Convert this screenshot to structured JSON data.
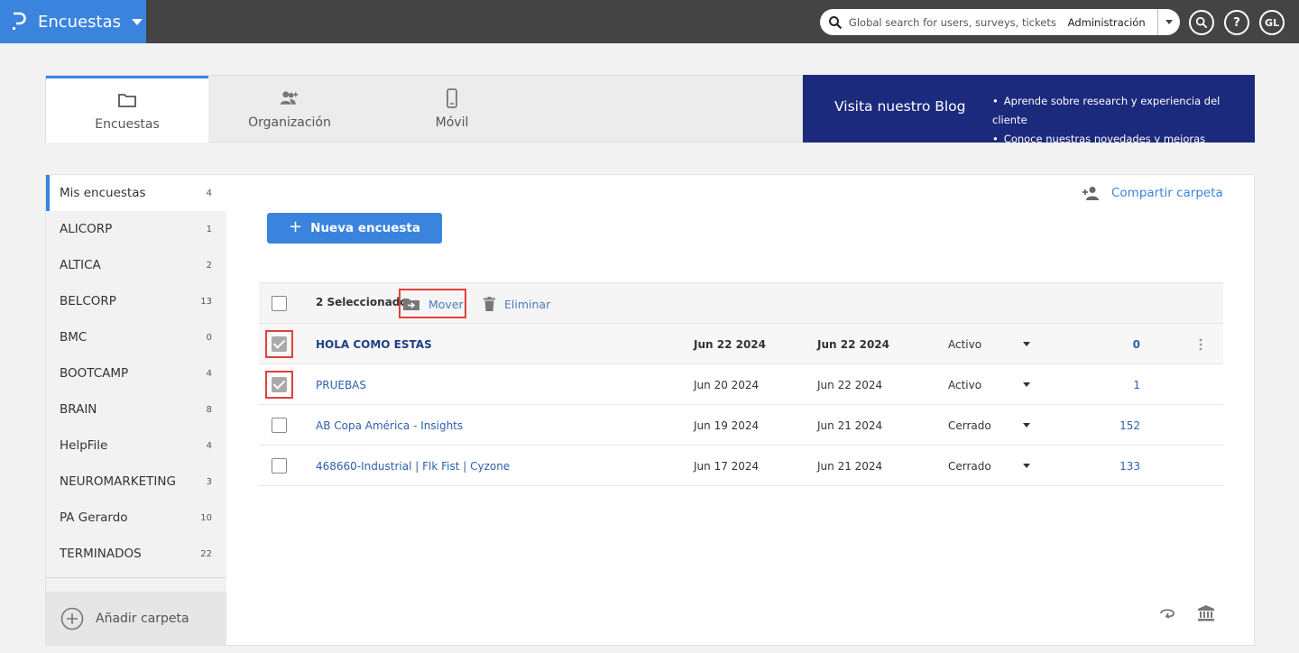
{
  "topbar": {
    "app_name": "Encuestas",
    "search_placeholder": "Global search for users, surveys, tickets",
    "search_scope": "Administración",
    "avatar_initials": "GL",
    "help_label": "?"
  },
  "tabs": [
    {
      "label": "Encuestas",
      "icon": "folder-icon"
    },
    {
      "label": "Organización",
      "icon": "add-user-icon"
    },
    {
      "label": "Móvil",
      "icon": "mobile-icon"
    }
  ],
  "blog": {
    "title": "Visita nuestro Blog",
    "points": [
      "Aprende sobre research y experiencia del cliente",
      "Conoce nuestras novedades y mejoras"
    ],
    "background_color": "#1c2a7d"
  },
  "sidebar": {
    "folders": [
      {
        "name": "Mis encuestas",
        "count": "4"
      },
      {
        "name": "ALICORP",
        "count": "1"
      },
      {
        "name": "ALTICA",
        "count": "2"
      },
      {
        "name": "BELCORP",
        "count": "13"
      },
      {
        "name": "BMC",
        "count": "0"
      },
      {
        "name": "BOOTCAMP",
        "count": "4"
      },
      {
        "name": "BRAIN",
        "count": "8"
      },
      {
        "name": "HelpFile",
        "count": "4"
      },
      {
        "name": "NEUROMARKETING",
        "count": "3"
      },
      {
        "name": "PA Gerardo",
        "count": "10"
      },
      {
        "name": "TERMINADOS",
        "count": "22"
      }
    ],
    "add_folder_label": "Añadir carpeta"
  },
  "main": {
    "share_label": "Compartir carpeta",
    "new_survey_label": "Nueva encuesta",
    "new_survey_plus": "+",
    "selected_label": "2 Seleccionado",
    "move_label": "Mover",
    "delete_label": "Eliminar",
    "menu_glyph": "⋮",
    "rows": [
      {
        "name": "HOLA COMO ESTAS",
        "created": "Jun 22 2024",
        "modified": "Jun 22 2024",
        "status": "Activo",
        "responses": "0",
        "checked": true
      },
      {
        "name": "PRUEBAS",
        "created": "Jun 20 2024",
        "modified": "Jun 22 2024",
        "status": "Activo",
        "responses": "1",
        "checked": true
      },
      {
        "name": "AB Copa América - Insights",
        "created": "Jun 19 2024",
        "modified": "Jun 21 2024",
        "status": "Cerrado",
        "responses": "152",
        "checked": false
      },
      {
        "name": "468660-Industrial | Flk Fist | Cyzone",
        "created": "Jun 17 2024",
        "modified": "Jun 21 2024",
        "status": "Cerrado",
        "responses": "133",
        "checked": false
      }
    ]
  },
  "colors": {
    "accent": "#3a84de",
    "topbar": "#444444",
    "highlight_border": "#e0403a"
  }
}
